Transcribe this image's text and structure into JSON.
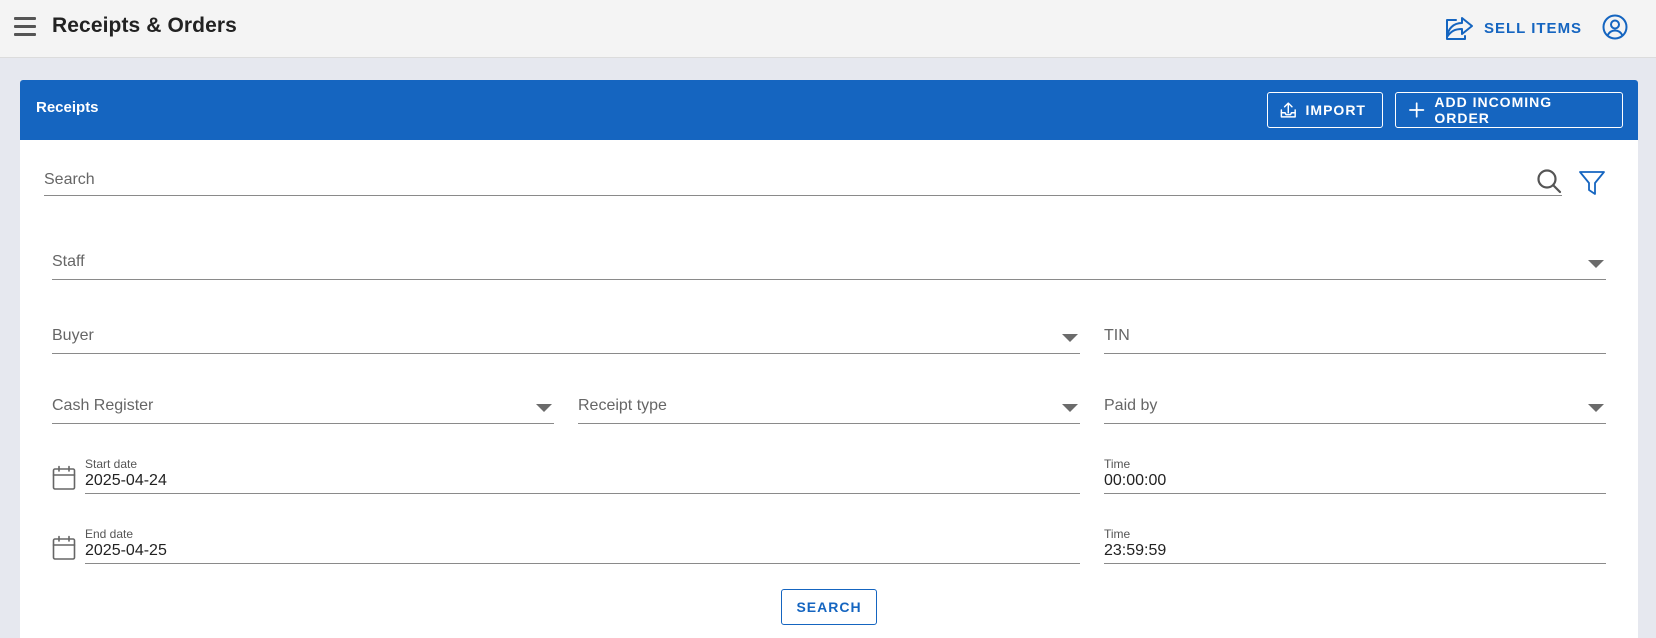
{
  "app": {
    "title": "Receipts & Orders"
  },
  "topbar": {
    "sell_items_label": "SELL ITEMS",
    "icons": [
      "menu-icon",
      "sell-arrow-icon",
      "account-circle-icon"
    ]
  },
  "receipts": {
    "title": "Receipts",
    "import_label": "IMPORT",
    "add_order_label": "ADD INCOMING ORDER"
  },
  "filters": {
    "search_placeholder": "Search",
    "staff_label": "Staff",
    "buyer_label": "Buyer",
    "tin_label": "TIN",
    "cash_register_label": "Cash Register",
    "receipt_type_label": "Receipt type",
    "paid_by_label": "Paid by",
    "start_date_label": "Start date",
    "start_date_value": "2025-04-24",
    "start_time_label": "Time",
    "start_time_value": "00:00:00",
    "end_date_label": "End date",
    "end_date_value": "2025-04-25",
    "end_time_label": "Time",
    "end_time_value": "23:59:59",
    "search_button_label": "SEARCH"
  },
  "colors": {
    "primary": "#1565c0",
    "topbar_bg": "#f4f4f4",
    "page_bg": "#e6e8ef"
  }
}
